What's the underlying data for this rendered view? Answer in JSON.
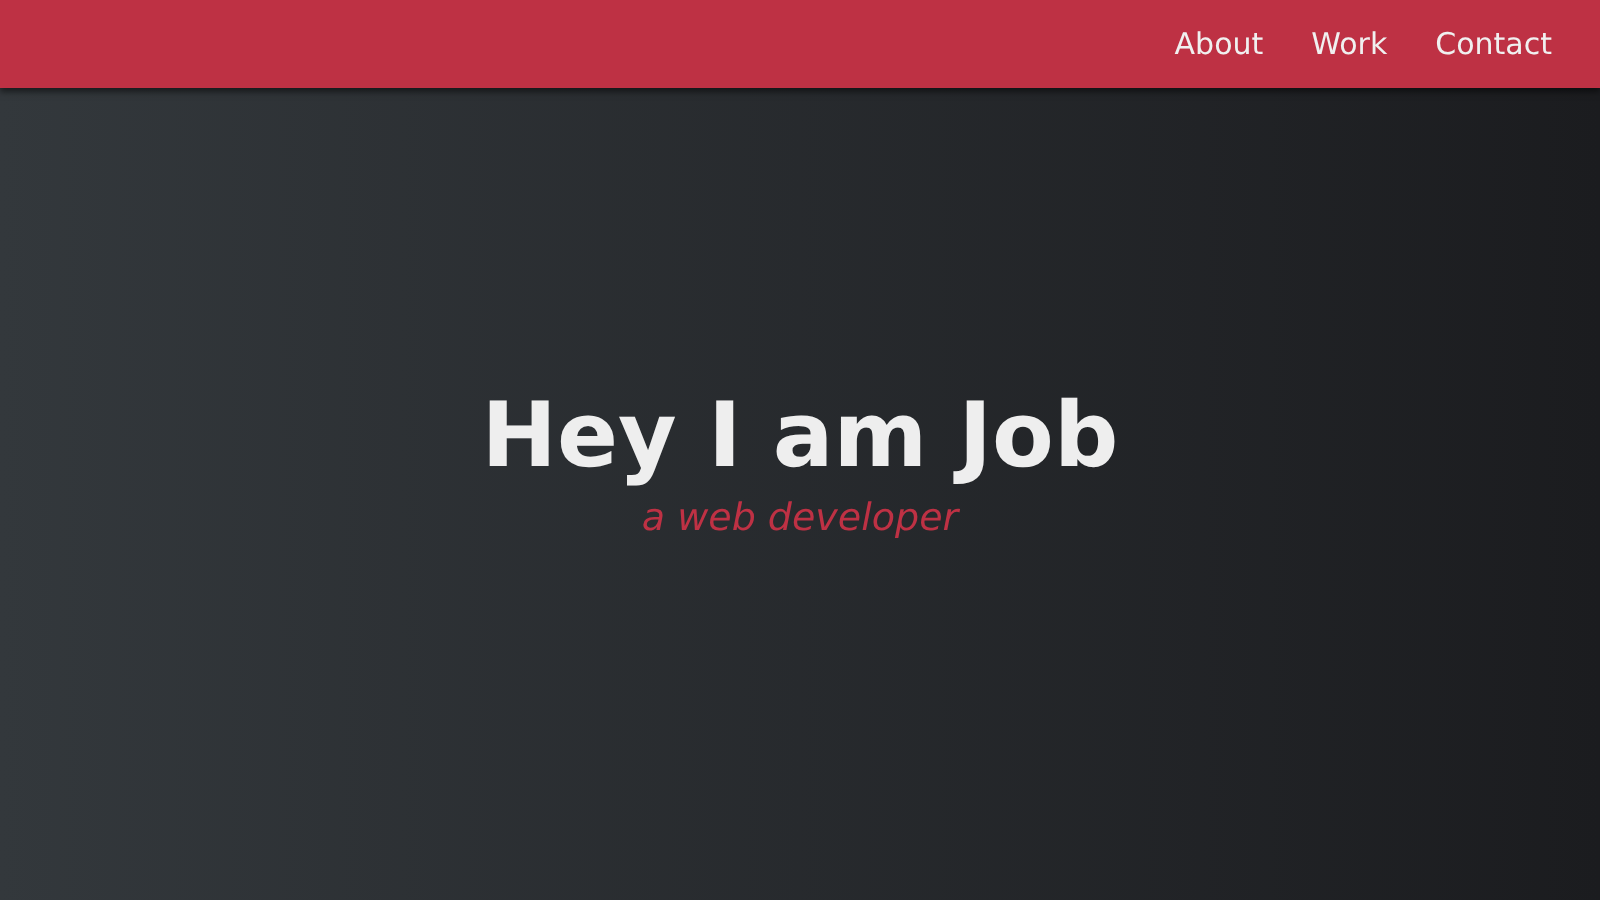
{
  "nav": {
    "links": [
      {
        "label": "About"
      },
      {
        "label": "Work"
      },
      {
        "label": "Contact"
      }
    ]
  },
  "hero": {
    "title": "Hey I am Job",
    "subtitle": "a web developer"
  }
}
